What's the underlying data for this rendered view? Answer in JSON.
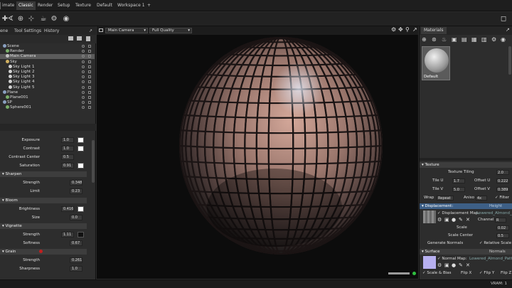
{
  "menu": {
    "tabs": [
      "imate",
      "Classic",
      "Render",
      "Setup",
      "Texture",
      "Default",
      "Workspace 1",
      "+"
    ],
    "active_index": 1
  },
  "left_panel": {
    "tabs": [
      "ene",
      "Tool Settings",
      "History"
    ],
    "tree": [
      {
        "label": "Scene",
        "indent": 1,
        "color": "#8aa0c0"
      },
      {
        "label": "Render",
        "indent": 2,
        "color": "#7ab06a"
      },
      {
        "label": "Main Camera",
        "indent": 2,
        "color": "#c0c0c0"
      },
      {
        "label": "Sky",
        "indent": 2,
        "color": "#d0b060"
      },
      {
        "label": "Sky Light 1",
        "indent": 3,
        "color": "#d0d0d0"
      },
      {
        "label": "Sky Light 2",
        "indent": 3,
        "color": "#d0d0d0"
      },
      {
        "label": "Sky Light 3",
        "indent": 3,
        "color": "#d0d0d0"
      },
      {
        "label": "Sky Light 4",
        "indent": 3,
        "color": "#d0d0d0"
      },
      {
        "label": "Sky Light 5",
        "indent": 3,
        "color": "#d0d0d0"
      },
      {
        "label": "Plane",
        "indent": 1,
        "color": "#8aa0c0"
      },
      {
        "label": "Plane001",
        "indent": 2,
        "color": "#7ab06a"
      },
      {
        "label": "SP",
        "indent": 1,
        "color": "#8aa0c0"
      },
      {
        "label": "Sphere001",
        "indent": 2,
        "color": "#7ab06a"
      }
    ],
    "selected_index": 2,
    "props_top": [
      {
        "label": "Exposure",
        "value": "1.0"
      },
      {
        "label": "Contrast",
        "value": "1.0"
      },
      {
        "label": "Contrast Center",
        "value": "0.5"
      },
      {
        "label": "Saturation",
        "value": "0.91"
      }
    ],
    "sharpen": {
      "title": "Sharpen",
      "rows": [
        {
          "label": "Strength",
          "value": "0.348"
        },
        {
          "label": "Limit",
          "value": "0.23"
        }
      ]
    },
    "bloom": {
      "title": "Bloom",
      "rows": [
        {
          "label": "Brightness",
          "value": "0.416"
        },
        {
          "label": "Size",
          "value": "0.0"
        }
      ]
    },
    "vignette": {
      "title": "Vignette",
      "rows": [
        {
          "label": "Strength",
          "value": "1.11"
        },
        {
          "label": "Softness",
          "value": "0.67"
        }
      ]
    },
    "grain": {
      "title": "Grain",
      "rows": [
        {
          "label": "Strength",
          "value": "0.261"
        },
        {
          "label": "Sharpness",
          "value": "1.0"
        }
      ]
    }
  },
  "viewport": {
    "camera": "Main Camera",
    "quality": "Full Quality"
  },
  "right_panel": {
    "tab": "Materials",
    "material_name": "Default",
    "texture": {
      "title": "Texture",
      "tiling_label": "Texture Tiling",
      "tiling": "2.0",
      "tile_u_label": "Tile U",
      "tile_u": "1.7",
      "offset_u_label": "Offset U",
      "offset_u": "0.222",
      "tile_v_label": "Tile V",
      "tile_v": "5.0",
      "offset_v_label": "Offset V",
      "offset_v": "0.389",
      "wrap_label": "Wrap",
      "wrap": "Repeat",
      "aniso_label": "Aniso",
      "aniso": "4x",
      "filter_label": "Filter"
    },
    "displacement": {
      "title": "Displacement:",
      "mode": "Height",
      "map_label": "Displacement Map:",
      "map_file": "Lowered_Almond_Pa",
      "channel_label": "Channel",
      "channel": "R",
      "scale_label": "Scale",
      "scale": "0.02",
      "scale_center_label": "Scale Center",
      "scale_center": "0.5",
      "gen_normals": "Generate Normals",
      "relative_scale": "Relative Scale"
    },
    "surface": {
      "title": "Surface",
      "mode": "Normals",
      "normal_label": "Normal Map:",
      "normal_file": "Lowered_Almond_PatternTi",
      "scale_bias": "Scale & Bias",
      "flip_x": "Flip X",
      "flip_y": "Flip Y",
      "flip_z": "Flip Z"
    }
  },
  "status": {
    "vram": "VRAM: 1"
  },
  "colors": {
    "accent": "#3d5f86",
    "selected": "#5b5b5b",
    "status_green": "#2fbf3f"
  }
}
